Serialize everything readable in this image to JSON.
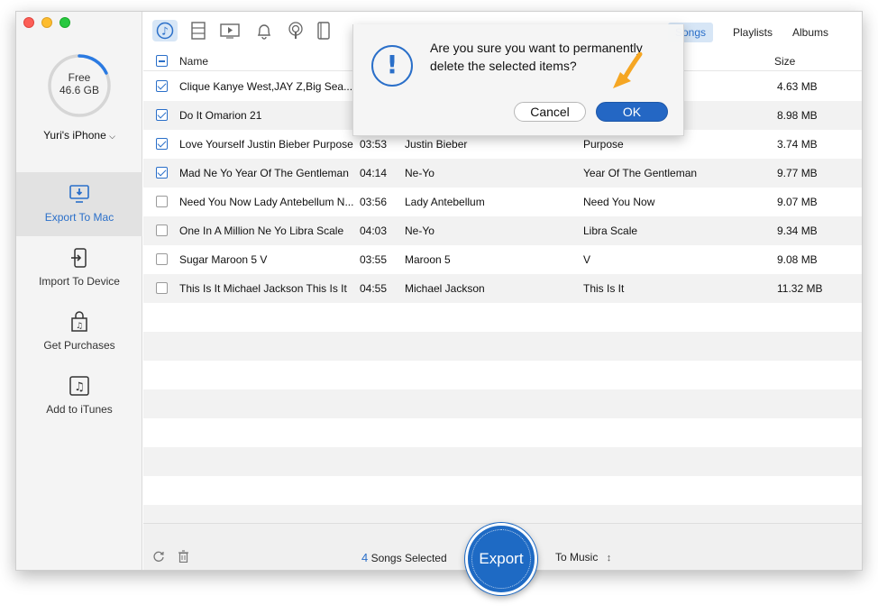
{
  "storage": {
    "label": "Free",
    "value": "46.6 GB",
    "used_fraction": 0.18
  },
  "device": {
    "name": "Yuri's iPhone",
    "chevron": "chevron-down-icon"
  },
  "nav": [
    {
      "label": "Export To Mac",
      "icon": "export-to-mac-icon",
      "active": true
    },
    {
      "label": "Import To Device",
      "icon": "import-to-device-icon",
      "active": false
    },
    {
      "label": "Get Purchases",
      "icon": "purchases-bag-icon",
      "active": false
    },
    {
      "label": "Add to iTunes",
      "icon": "itunes-note-icon",
      "active": false
    }
  ],
  "toolbar": {
    "icons": [
      "music-icon",
      "film-icon",
      "video-icon",
      "ringtone-bell-icon",
      "podcast-icon",
      "book-icon"
    ],
    "tabs": [
      {
        "label": "Songs",
        "active": true
      },
      {
        "label": "Playlists",
        "active": false
      },
      {
        "label": "Albums",
        "active": false
      }
    ]
  },
  "table": {
    "columns": [
      "Name",
      "Size"
    ],
    "rows": [
      {
        "checked": true,
        "name": "Clique Kanye West,JAY Z,Big Sea...",
        "time": "",
        "artist": "",
        "album": "",
        "size": "4.63 MB"
      },
      {
        "checked": true,
        "name": "Do It Omarion 21",
        "time": "",
        "artist": "",
        "album": "",
        "size": "8.98 MB"
      },
      {
        "checked": true,
        "name": "Love Yourself Justin Bieber Purpose",
        "time": "03:53",
        "artist": "Justin Bieber",
        "album": "Purpose",
        "size": "3.74 MB"
      },
      {
        "checked": true,
        "name": "Mad Ne Yo Year Of The Gentleman",
        "time": "04:14",
        "artist": "Ne-Yo",
        "album": "Year Of The Gentleman",
        "size": "9.77 MB"
      },
      {
        "checked": false,
        "name": "Need You Now Lady Antebellum N...",
        "time": "03:56",
        "artist": "Lady Antebellum",
        "album": "Need You Now",
        "size": "9.07 MB"
      },
      {
        "checked": false,
        "name": "One In A Million Ne Yo Libra Scale",
        "time": "04:03",
        "artist": "Ne-Yo",
        "album": "Libra Scale",
        "size": "9.34 MB"
      },
      {
        "checked": false,
        "name": "Sugar Maroon 5 V",
        "time": "03:55",
        "artist": "Maroon 5",
        "album": "V",
        "size": "9.08 MB"
      },
      {
        "checked": false,
        "name": "This Is It Michael Jackson This Is It",
        "time": "04:55",
        "artist": "Michael Jackson",
        "album": "This Is It",
        "size": "11.32 MB"
      }
    ]
  },
  "footer": {
    "selected_count": "4",
    "selected_label": "Songs Selected",
    "export_label": "Export",
    "destination": "To Music",
    "icons": [
      "refresh-icon",
      "trash-icon",
      "updown-chevron-icon"
    ]
  },
  "dialog": {
    "message": "Are you sure you want to permanently delete the selected items?",
    "icon": "!",
    "cancel_label": "Cancel",
    "ok_label": "OK"
  },
  "colors": {
    "accent": "#2a6fc9",
    "export_button": "#1e6ac4",
    "cursor": "#f5a623"
  }
}
